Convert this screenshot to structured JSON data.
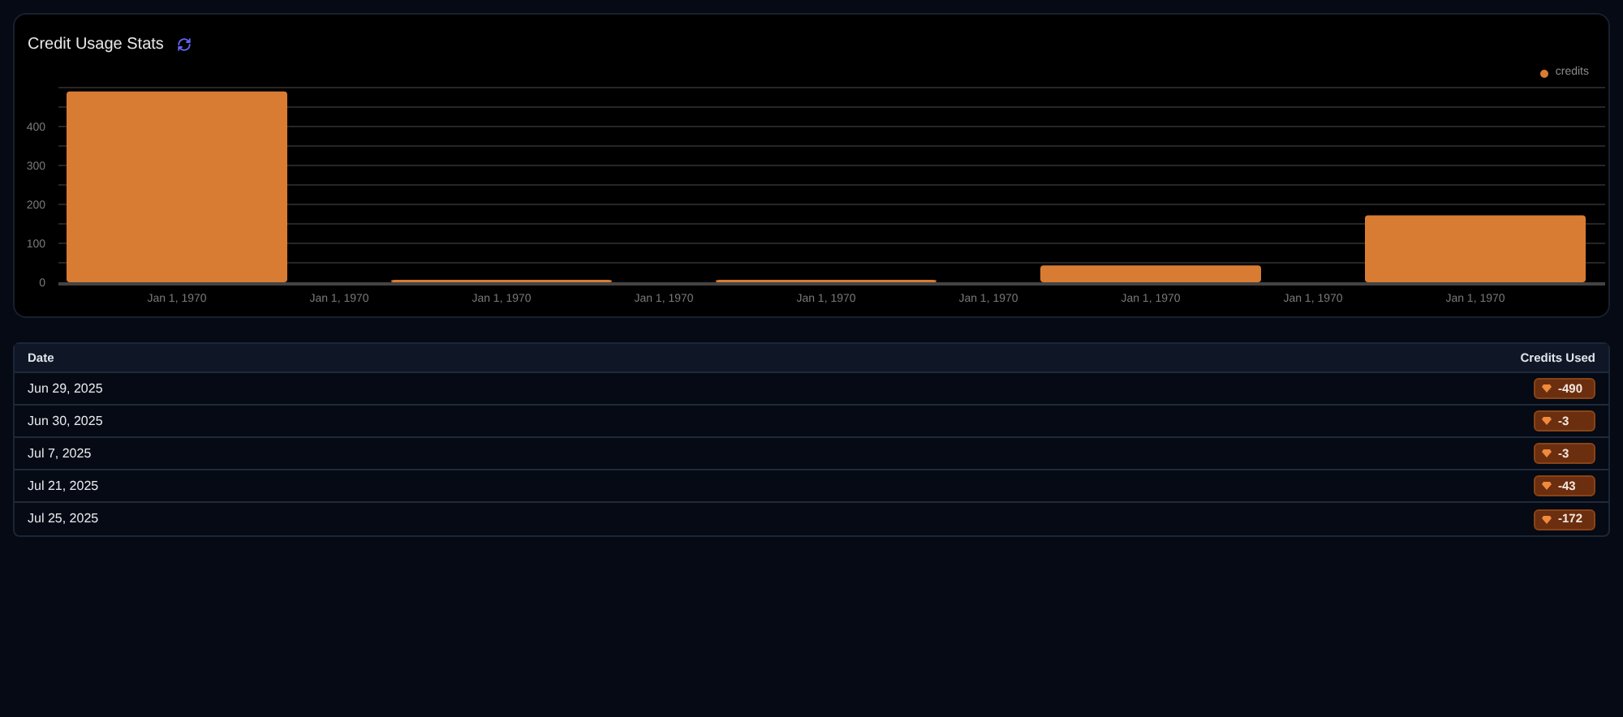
{
  "card": {
    "title": "Credit Usage Stats",
    "chart_data": {
      "type": "bar",
      "categories": [
        "Jan 1, 1970",
        "Jan 1, 1970",
        "Jan 1, 1970",
        "Jan 1, 1970",
        "Jan 1, 1970",
        "Jan 1, 1970",
        "Jan 1, 1970",
        "Jan 1, 1970",
        "Jan 1, 1970"
      ],
      "series": [
        {
          "name": "credits",
          "color": "#d97c33",
          "values": [
            490,
            null,
            3,
            null,
            3,
            null,
            43,
            null,
            172
          ]
        }
      ],
      "ylim": [
        0,
        500
      ],
      "grid": true,
      "yticks": [
        0,
        100,
        200,
        300,
        400
      ]
    }
  },
  "table": {
    "columns": [
      "Date",
      "Credits Used"
    ],
    "rows": [
      {
        "date": "Jun 29, 2025",
        "credits": "-490"
      },
      {
        "date": "Jun 30, 2025",
        "credits": "-3"
      },
      {
        "date": "Jul 7, 2025",
        "credits": "-3"
      },
      {
        "date": "Jul 21, 2025",
        "credits": "-43"
      },
      {
        "date": "Jul 25, 2025",
        "credits": "-172"
      }
    ]
  }
}
